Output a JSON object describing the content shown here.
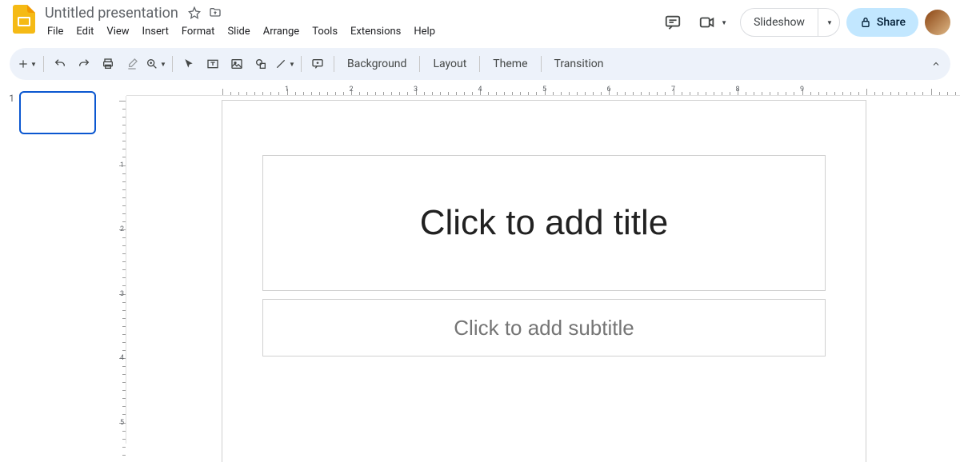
{
  "header": {
    "doc_title": "Untitled presentation",
    "menus": [
      "File",
      "Edit",
      "View",
      "Insert",
      "Format",
      "Slide",
      "Arrange",
      "Tools",
      "Extensions",
      "Help"
    ],
    "slideshow_label": "Slideshow",
    "share_label": "Share"
  },
  "toolbar": {
    "background": "Background",
    "layout": "Layout",
    "theme": "Theme",
    "transition": "Transition"
  },
  "filmstrip": {
    "slides": [
      {
        "num": "1"
      }
    ]
  },
  "canvas": {
    "title_placeholder": "Click to add title",
    "subtitle_placeholder": "Click to add subtitle"
  },
  "ruler_h": [
    "1",
    "2",
    "3",
    "4",
    "5",
    "6",
    "7",
    "8",
    "9"
  ],
  "ruler_v": [
    "1",
    "2",
    "3",
    "4",
    "5"
  ]
}
